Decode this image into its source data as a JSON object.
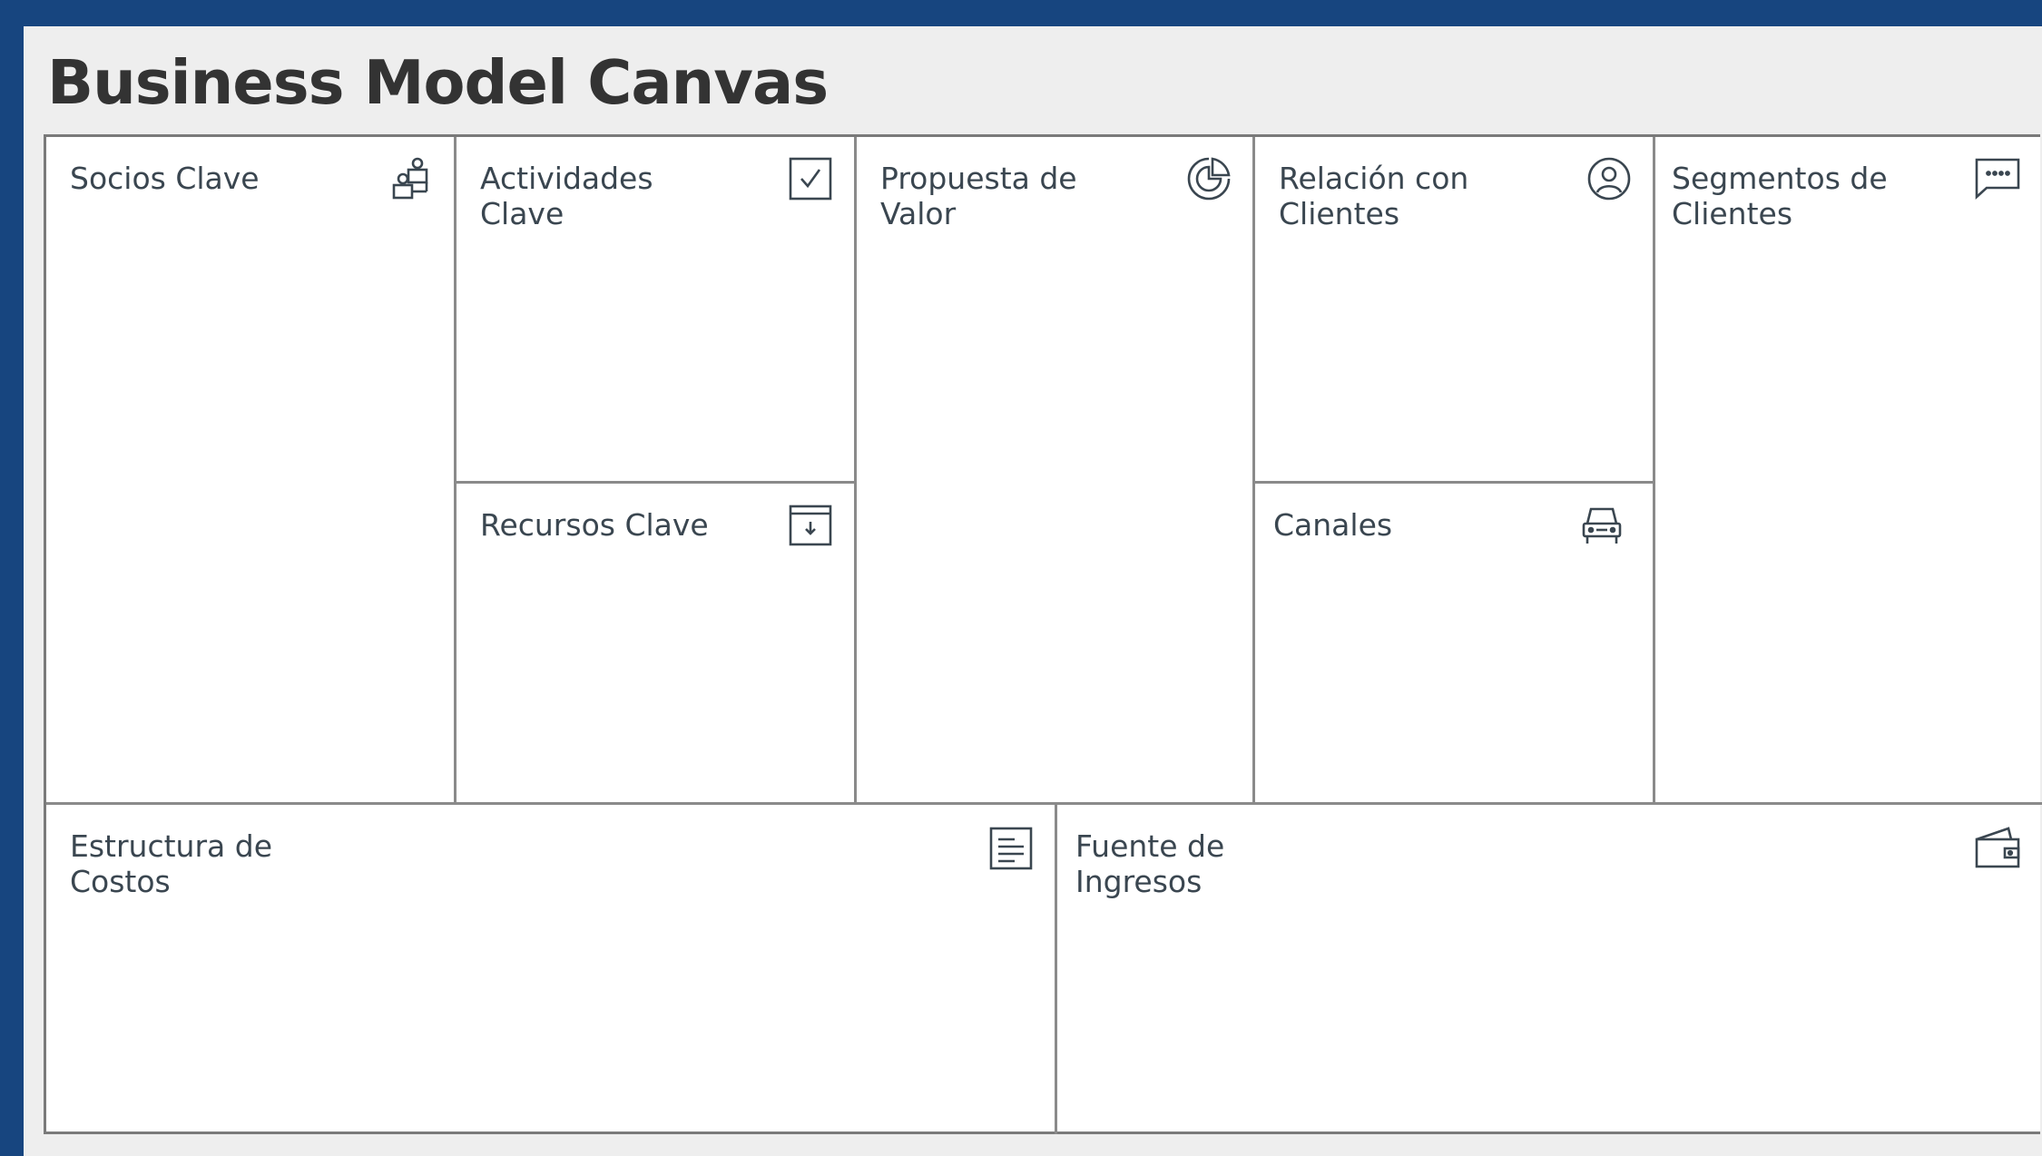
{
  "title": "Business Model Canvas",
  "colors": {
    "frame": "#17457f",
    "sheet": "#eeeeee",
    "canvas": "#ffffff",
    "lines": "#8a8a8a",
    "title_text": "#333333",
    "label_text": "#3a4650"
  },
  "blocks": {
    "socios": {
      "label": "Socios Clave",
      "icon": "partners-icon"
    },
    "actividades": {
      "label": "Actividades\nClave",
      "icon": "checkbox-icon"
    },
    "recursos": {
      "label": "Recursos Clave",
      "icon": "archive-box-icon"
    },
    "propuesta": {
      "label": "Propuesta de\nValor",
      "icon": "refresh-pie-icon"
    },
    "relacion": {
      "label": "Relación con\nClientes",
      "icon": "user-circle-icon"
    },
    "canales": {
      "label": "Canales",
      "icon": "car-icon"
    },
    "segmentos": {
      "label": "Segmentos de\nClientes",
      "icon": "chat-bubble-icon"
    },
    "costos": {
      "label": "Estructura de\nCostos",
      "icon": "document-lines-icon"
    },
    "ingresos": {
      "label": "Fuente de\nIngresos",
      "icon": "wallet-icon"
    }
  }
}
